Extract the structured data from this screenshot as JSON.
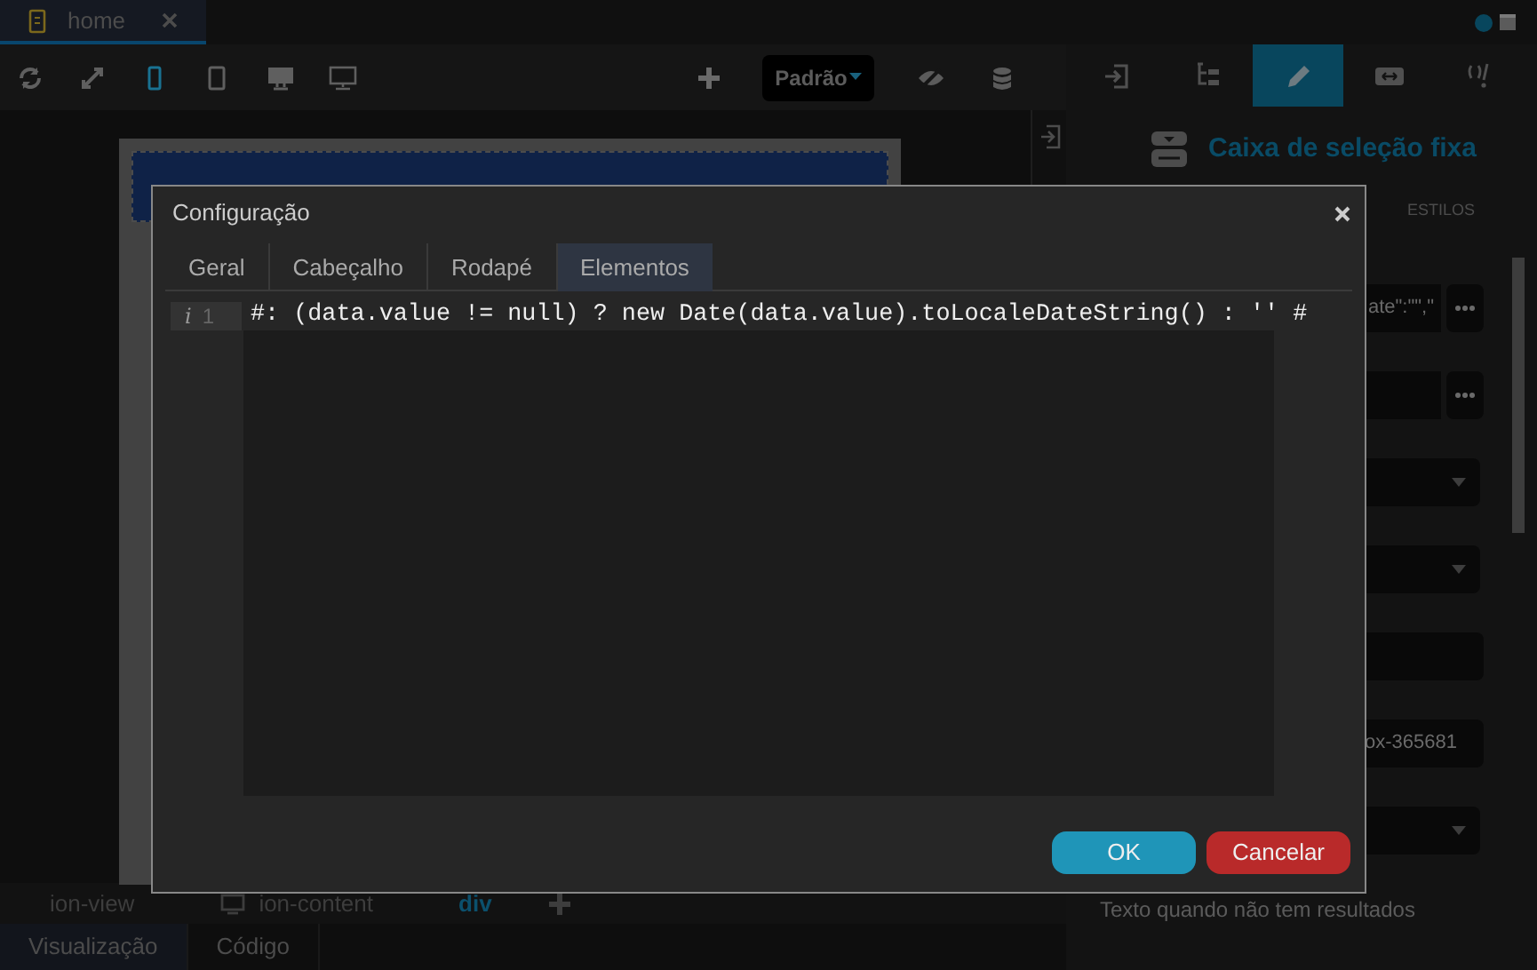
{
  "file_tabs": [
    {
      "label": "home",
      "selected": true
    }
  ],
  "toolbar": {
    "devices": [
      {
        "kind": "refresh",
        "selected": false
      },
      {
        "kind": "expand",
        "selected": false
      },
      {
        "kind": "phone",
        "selected": true
      },
      {
        "kind": "tablet",
        "selected": false
      },
      {
        "kind": "desktop",
        "selected": false
      },
      {
        "kind": "monitor",
        "selected": false
      }
    ],
    "mode_dropdown": "Padrão"
  },
  "side_tabs": [
    {
      "kind": "import",
      "selected": false
    },
    {
      "kind": "tree",
      "selected": false
    },
    {
      "kind": "pencil",
      "selected": true
    },
    {
      "kind": "resize",
      "selected": false
    },
    {
      "kind": "code",
      "selected": false
    }
  ],
  "inspector": {
    "title": "Caixa de seleção fixa",
    "tab": "ESTILOS",
    "fields": [
      {
        "kind": "button-field",
        "value": "ate\":\"\",\""
      },
      {
        "kind": "button-field"
      },
      {
        "kind": "select"
      },
      {
        "kind": "select"
      },
      {
        "kind": "text"
      },
      {
        "kind": "text",
        "value": "ox-365681"
      },
      {
        "kind": "select"
      }
    ],
    "hint": "Texto quando não tem resultados"
  },
  "breadcrumb": [
    {
      "label": "ion-view",
      "selected": false
    },
    {
      "label": "ion-content",
      "selected": false
    },
    {
      "label": "div",
      "selected": true
    }
  ],
  "bottom_tabs": [
    {
      "label": "Visualização",
      "selected": true
    },
    {
      "label": "Código",
      "selected": false
    }
  ],
  "dialog": {
    "title": "Configuração",
    "tabs": [
      {
        "label": "Geral",
        "selected": false
      },
      {
        "label": "Cabeçalho",
        "selected": false
      },
      {
        "label": "Rodapé",
        "selected": false
      },
      {
        "label": "Elementos",
        "selected": true
      }
    ],
    "code_lines": [
      {
        "marker": "i",
        "number": "1",
        "text": "#: (data.value != null) ? new Date(data.value).toLocaleDateString() : '' #"
      }
    ],
    "buttons": [
      {
        "kind": "primary",
        "label": "OK"
      },
      {
        "kind": "danger",
        "label": "Cancelar"
      }
    ]
  }
}
